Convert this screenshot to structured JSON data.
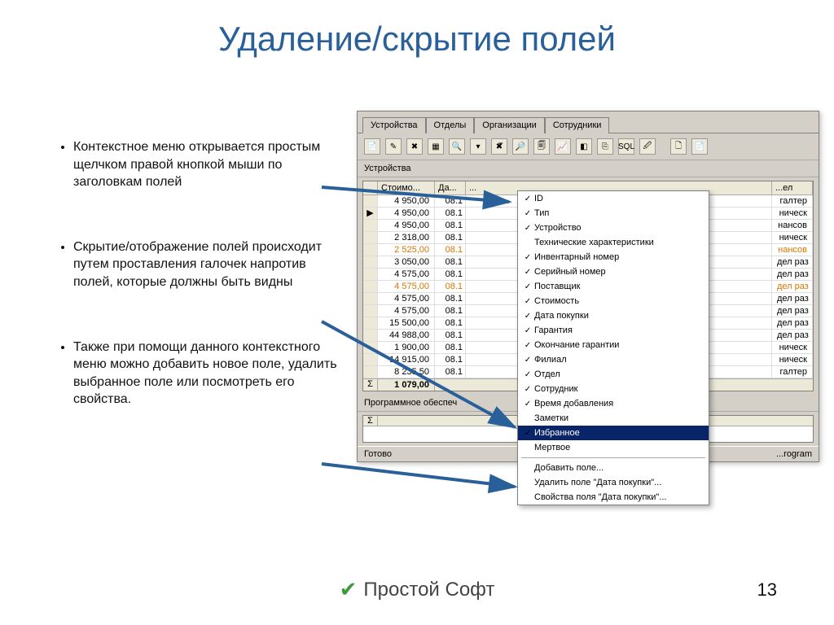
{
  "title": "Удаление/скрытие полей",
  "bullets": [
    "Контекстное меню открывается простым щелчком правой кнопкой мыши по заголовкам полей",
    "Скрытие/отображение полей происходит путем проставления галочек напротив полей, которые должны быть видны",
    "Также при помощи данного контекстного меню можно добавить новое поле, удалить выбранное поле или посмотреть его свойства."
  ],
  "pagenum": "13",
  "logo_text": "Простой Софт",
  "tabs": [
    "Устройства",
    "Отделы",
    "Организации",
    "Сотрудники"
  ],
  "toolbar_icons": [
    "📄",
    "✎",
    "✖",
    "▦",
    "🔍",
    "▾",
    "✖̅",
    "🔎",
    "🗐",
    "📈",
    "◧",
    "⎘",
    "SQL",
    "🖉",
    "",
    "🗋",
    "📄"
  ],
  "section_label": "Устройства",
  "grid": {
    "headers": [
      "",
      "Стоимо...",
      "Да...",
      "...",
      "...ел"
    ],
    "rows": [
      {
        "m": "",
        "cost": "4 950,00",
        "date": "08.1",
        "branch": "галтер",
        "hl": false
      },
      {
        "m": "▶",
        "cost": "4 950,00",
        "date": "08.1",
        "branch": "ническ",
        "hl": false
      },
      {
        "m": "",
        "cost": "4 950,00",
        "date": "08.1",
        "branch": "нансов",
        "hl": false
      },
      {
        "m": "",
        "cost": "2 318,00",
        "date": "08.1",
        "branch": "ническ",
        "hl": false
      },
      {
        "m": "",
        "cost": "2 525,00",
        "date": "08.1",
        "branch": "нансов",
        "hl": true
      },
      {
        "m": "",
        "cost": "3 050,00",
        "date": "08.1",
        "branch": "дел раз",
        "hl": false
      },
      {
        "m": "",
        "cost": "4 575,00",
        "date": "08.1",
        "branch": "дел раз",
        "hl": false
      },
      {
        "m": "",
        "cost": "4 575,00",
        "date": "08.1",
        "branch": "дел раз",
        "hl": true
      },
      {
        "m": "",
        "cost": "4 575,00",
        "date": "08.1",
        "branch": "дел раз",
        "hl": false
      },
      {
        "m": "",
        "cost": "4 575,00",
        "date": "08.1",
        "branch": "дел раз",
        "hl": false
      },
      {
        "m": "",
        "cost": "15 500,00",
        "date": "08.1",
        "branch": "дел раз",
        "hl": false
      },
      {
        "m": "",
        "cost": "44 988,00",
        "date": "08.1",
        "branch": "дел раз",
        "hl": false
      },
      {
        "m": "",
        "cost": "1 900,00",
        "date": "08.1",
        "branch": "ническ",
        "hl": false
      },
      {
        "m": "",
        "cost": "14 915,00",
        "date": "08.1",
        "branch": "ническ",
        "hl": false
      },
      {
        "m": "",
        "cost": "8 235,50",
        "date": "08.1",
        "branch": "галтер",
        "hl": false
      }
    ],
    "sum_label": "Σ",
    "sum": "1 079,00"
  },
  "sub_section": "Программное обеспеч",
  "status_left": "Готово",
  "status_right": "...rogram",
  "context_menu": {
    "items": [
      {
        "chk": true,
        "label": "ID"
      },
      {
        "chk": true,
        "label": "Тип"
      },
      {
        "chk": true,
        "label": "Устройство"
      },
      {
        "chk": false,
        "label": "Технические характеристики"
      },
      {
        "chk": true,
        "label": "Инвентарный номер"
      },
      {
        "chk": true,
        "label": "Серийный номер"
      },
      {
        "chk": true,
        "label": "Поставщик"
      },
      {
        "chk": true,
        "label": "Стоимость"
      },
      {
        "chk": true,
        "label": "Дата покупки"
      },
      {
        "chk": true,
        "label": "Гарантия"
      },
      {
        "chk": true,
        "label": "Окончание гарантии"
      },
      {
        "chk": true,
        "label": "Филиал"
      },
      {
        "chk": true,
        "label": "Отдел"
      },
      {
        "chk": true,
        "label": "Сотрудник"
      },
      {
        "chk": true,
        "label": "Время добавления"
      },
      {
        "chk": false,
        "label": "Заметки"
      },
      {
        "chk": true,
        "label": "Избранное",
        "selected": true
      },
      {
        "chk": false,
        "label": "Мертвое"
      }
    ],
    "actions": [
      "Добавить поле...",
      "Удалить поле \"Дата покупки\"...",
      "Свойства поля \"Дата покупки\"..."
    ]
  }
}
